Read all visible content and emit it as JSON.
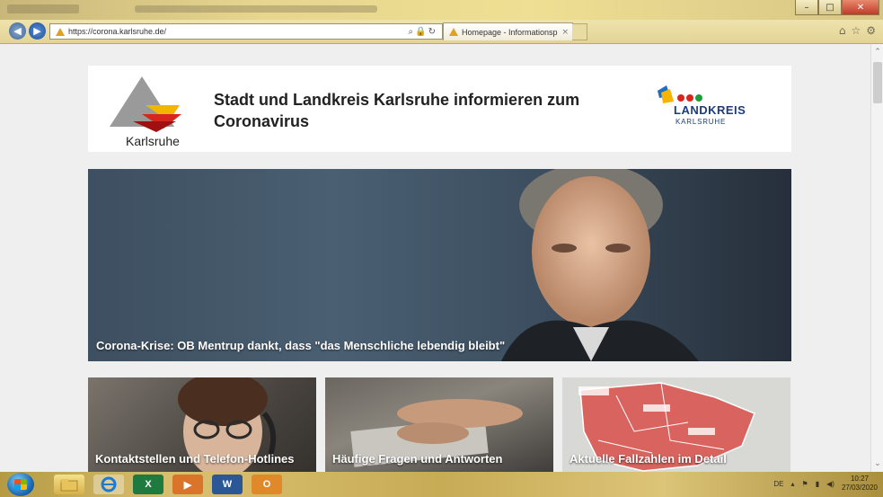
{
  "browser": {
    "url": "https://corona.karlsruhe.de/",
    "tab_title": "Homepage - Informationsp...",
    "tab_close": "×",
    "window_min": "–",
    "window_max": "□",
    "window_close": "✕"
  },
  "site": {
    "logo_left_text": "Karlsruhe",
    "headline": "Stadt und Landkreis Karlsruhe informieren zum Coronavirus",
    "logo_right_title": "LANDKREIS",
    "logo_right_sub": "KARLSRUHE"
  },
  "hero": {
    "caption": "Corona-Krise: OB Mentrup dankt, dass \"das Menschliche lebendig bleibt\""
  },
  "tiles": [
    {
      "caption": "Kontaktstellen und Telefon-Hotlines"
    },
    {
      "caption": "Häufige Fragen und Antworten"
    },
    {
      "caption": "Aktuelle Fallzahlen im Detail"
    }
  ],
  "taskbar": {
    "language": "DE",
    "time": "10:27",
    "date": "27/03/2020",
    "apps": [
      "start",
      "explorer",
      "internet-explorer",
      "excel",
      "media-player",
      "word",
      "outlook"
    ]
  },
  "colors": {
    "brand_blue": "#1b3d7a",
    "hero_bg": "#3d4f60",
    "taskbar": "#c8ab55"
  }
}
